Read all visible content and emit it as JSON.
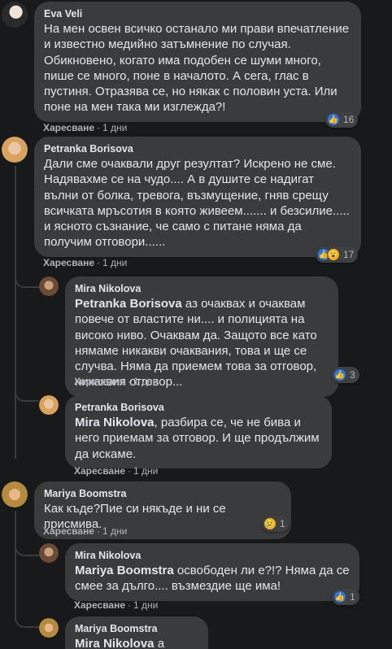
{
  "comments": [
    {
      "name": "Eva Veli",
      "text": "На мен освен всичко останало ми прави впечатление и известно медийно затъмнение по случая. Обикновено, когато има подобен се шуми много, пише се много, поне в началото. А сега, глас в пустиня. Отразява се, но някак с половин уста. Или поне на мен така ми изглежда?!",
      "like_label": "Харесване",
      "time": "1 дни",
      "reaction_count": "16"
    },
    {
      "name": "Petranka Borisova",
      "text": "Дали сме очаквали друг резултат? Искрено не сме. Надявахме се на чудо.... А в душите се надигат вълни от болка, тревога, възмущение, гняв срещу всичката мръсотия в която живеем....... и безсилие..... и ясното съзнание, че само с питане няма да получим отговори......",
      "like_label": "Харесване",
      "time": "1 дни",
      "reaction_count": "17"
    },
    {
      "name": "Mira Nikolova",
      "mention": "Petranka Borisova",
      "text": " аз очаквах и очаквам повече от властите ни.... и полицията на високо ниво. Очаквам да. Защото все като нямаме никакви очаквания, това и ще се случва. Няма да приемем това за отговор, никаквия отговор...",
      "like_label": "Харесване",
      "time": "1 дни",
      "reaction_count": "3"
    },
    {
      "name": "Petranka Borisova",
      "mention": "Mira Nikolova",
      "text": ", разбира се, че не бива и него приемам за отговор. И ще продължим да искаме.",
      "like_label": "Харесване",
      "time": "1 дни"
    },
    {
      "name": "Mariya Boomstra",
      "text": "Как къде?Пие си някъде и ни се присмива.",
      "like_label": "Харесване",
      "time": "1 дни",
      "reaction_count": "1"
    },
    {
      "name": "Mira Nikolova",
      "mention": "Mariya Boomstra",
      "text": " освободен ли е?!? Няма да се смее за дълго.... възмездие ще има!",
      "like_label": "Харесване",
      "time": "1 дни",
      "reaction_count": "1"
    },
    {
      "name": "Mariya Boomstra",
      "mention": "Mira Nikolova",
      "text": " а дано!"
    }
  ],
  "dot": "·",
  "colors": {
    "background": "#18191a",
    "bubble": "#3a3b3c",
    "like_blue": "#2078f4",
    "emoji_yellow": "#f7b125"
  },
  "icons": {
    "like": "like-reaction-icon",
    "wow": "wow-reaction-icon",
    "sad": "sad-reaction-icon"
  }
}
